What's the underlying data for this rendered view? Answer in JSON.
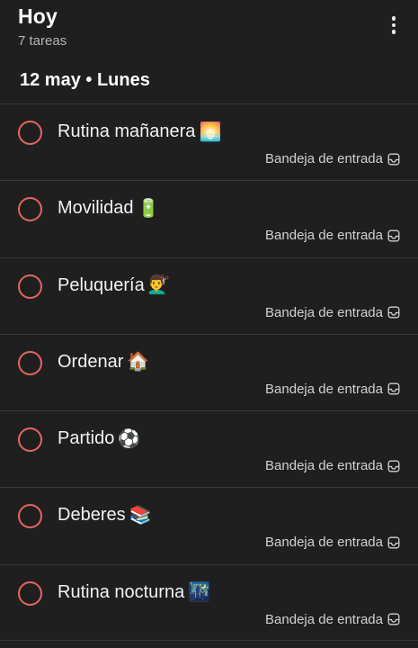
{
  "header": {
    "title": "Hoy",
    "subtitle": "7 tareas"
  },
  "date_header": "12 may • Lunes",
  "colors": {
    "background": "#1f1f1f",
    "checkbox_border": "#e3675f",
    "divider": "#3a3a3a"
  },
  "tasks": [
    {
      "content": "Rutina mañanera",
      "emoji": "🌅",
      "project": "Bandeja de entrada",
      "project_icon": "inbox-icon"
    },
    {
      "content": "Movilidad",
      "emoji": "🔋",
      "project": "Bandeja de entrada",
      "project_icon": "inbox-icon"
    },
    {
      "content": "Peluquería",
      "emoji": "💇‍♂️",
      "project": "Bandeja de entrada",
      "project_icon": "inbox-icon"
    },
    {
      "content": "Ordenar",
      "emoji": "🏠",
      "project": "Bandeja de entrada",
      "project_icon": "inbox-icon"
    },
    {
      "content": "Partido",
      "emoji": "⚽",
      "project": "Bandeja de entrada",
      "project_icon": "inbox-icon"
    },
    {
      "content": "Deberes",
      "emoji": "📚",
      "project": "Bandeja de entrada",
      "project_icon": "inbox-icon"
    },
    {
      "content": "Rutina nocturna",
      "emoji": "🌃",
      "project": "Bandeja de entrada",
      "project_icon": "inbox-icon"
    }
  ]
}
